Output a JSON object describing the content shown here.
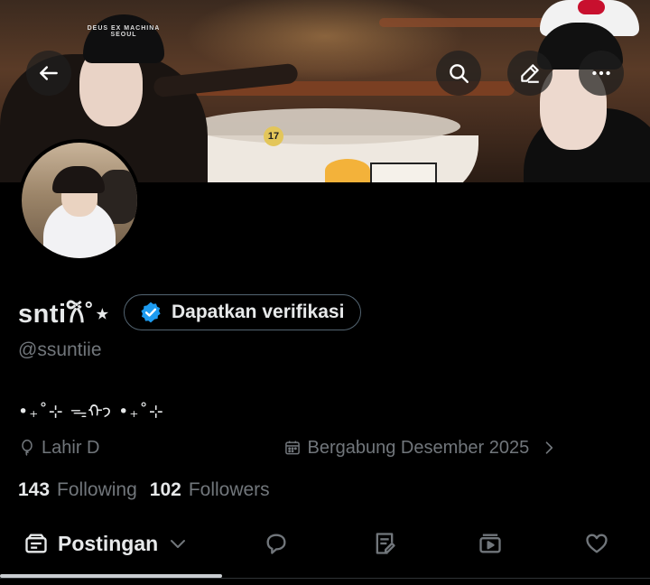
{
  "header": {
    "back_icon": "arrow-left-icon",
    "search_icon": "search-icon",
    "edit_icon": "pencil-icon",
    "more_icon": "more-horizontal-icon",
    "banner_cap_text": "DEUS EX MACHINA SEOUL",
    "banner_table_number": "17"
  },
  "profile": {
    "display_name": "snti𐙚˚⋆",
    "verify_label": "Dapatkan verifikasi",
    "handle": "@ssuntiie",
    "bio": "•₊˚⊹ ᯓᡣ𐭩 •₊˚⊹",
    "birth_label": "Lahir D",
    "joined_label": "Bergabung Desember 2025"
  },
  "stats": {
    "following_count": "143",
    "following_label": "Following",
    "followers_count": "102",
    "followers_label": "Followers"
  },
  "tabs": {
    "posts_label": "Postingan"
  },
  "colors": {
    "background": "#000000",
    "primary_text": "#e7e9ea",
    "secondary_text": "#71767b",
    "verified_blue": "#1d9bf0",
    "border": "#536471"
  }
}
